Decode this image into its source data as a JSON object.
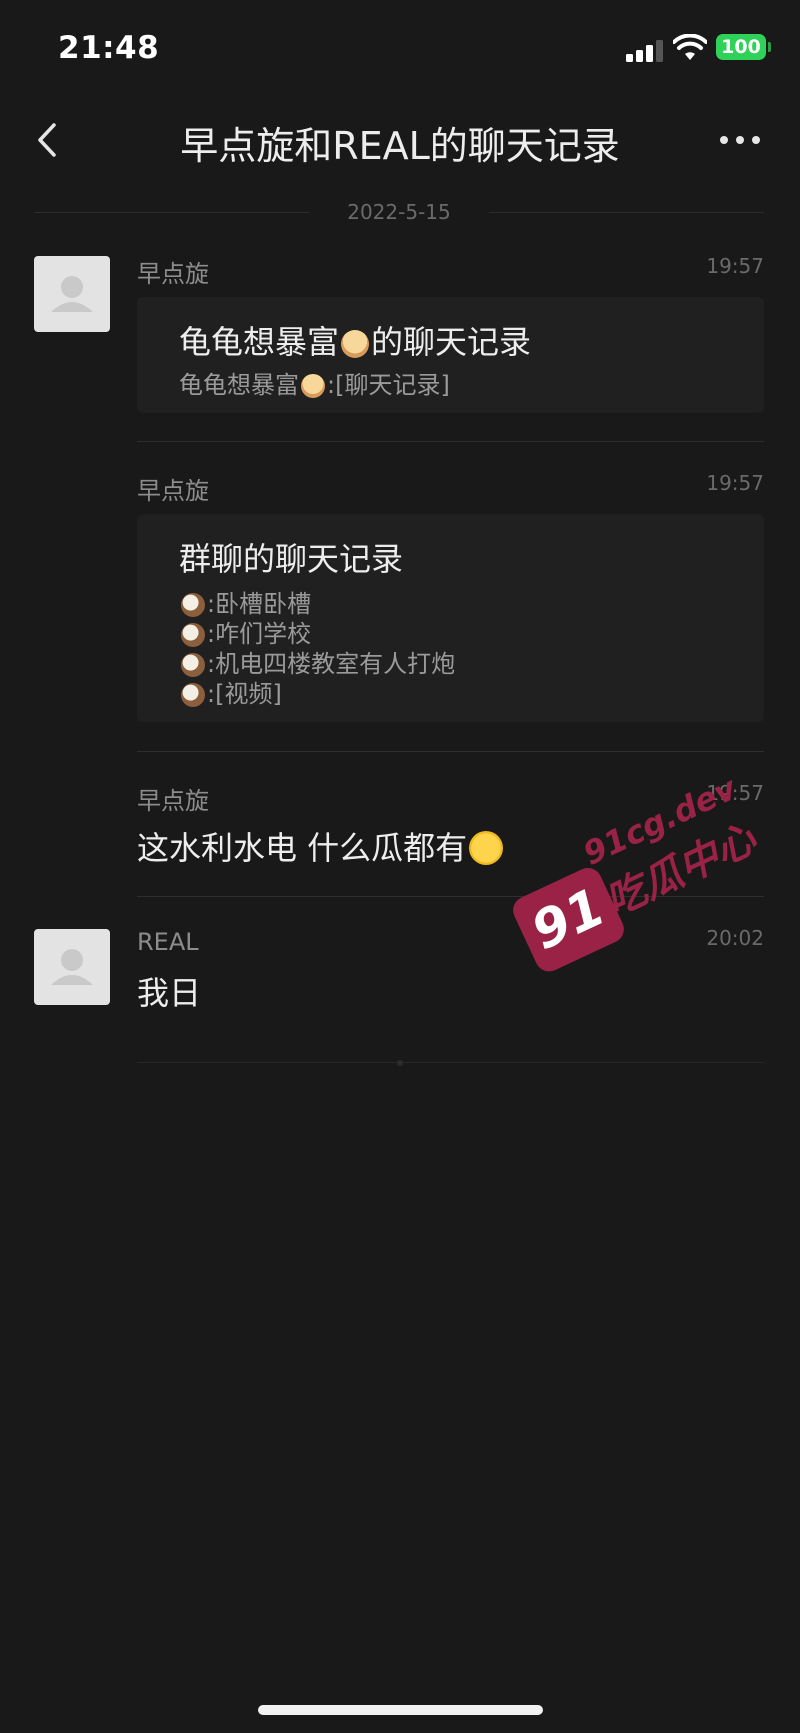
{
  "status_bar": {
    "time": "21:48",
    "battery": "100"
  },
  "header": {
    "title": "早点旋和REAL的聊天记录"
  },
  "date_divider": "2022-5-15",
  "messages": [
    {
      "sender": "早点旋",
      "time": "19:57",
      "card": {
        "title_prefix": "龟龟想暴富",
        "title_suffix": "的聊天记录",
        "line_prefix": "龟龟想暴富",
        "line_suffix": ":[聊天记录]"
      }
    },
    {
      "sender": "早点旋",
      "time": "19:57",
      "card": {
        "title": "群聊的聊天记录",
        "lines": [
          ":卧槽卧槽",
          ":咋们学校",
          ":机电四楼教室有人打炮",
          ":[视频]"
        ]
      }
    },
    {
      "sender": "早点旋",
      "time": "19:57",
      "text": "这水利水电 什么瓜都有"
    },
    {
      "sender": "REAL",
      "time": "20:02",
      "text": "我日"
    }
  ],
  "watermark": {
    "badge": "91",
    "url": "91cg.dev",
    "name": "吃瓜中心"
  },
  "icons": {
    "back": "chevron-left-icon",
    "more": "more-dots-icon",
    "avatar": "default-avatar-icon",
    "emoji_person": "person-raising-hand-emoji",
    "emoji_coconut": "coconut-emoji",
    "emoji_anxious": "anxious-sweat-emoji"
  },
  "colors": {
    "background": "#191919",
    "battery": "#30d158",
    "watermark": "#9a2246"
  }
}
